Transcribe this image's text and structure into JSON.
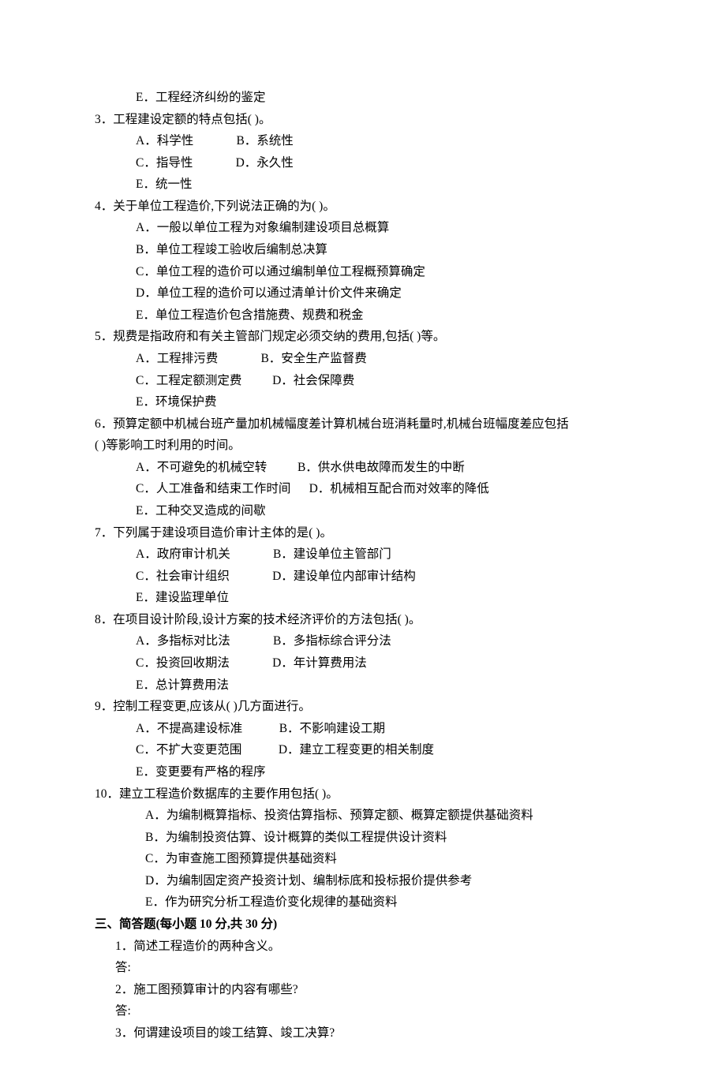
{
  "q2": {
    "optE": "E．工程经济纠纷的鉴定"
  },
  "q3": {
    "stem": "3．工程建设定额的特点包括(    )。",
    "row1": "A．科学性              B．系统性",
    "row2": "C．指导性              D．永久性",
    "row3": "E．统一性"
  },
  "q4": {
    "stem": "4．关于单位工程造价,下列说法正确的为(    )。",
    "a": "A．一般以单位工程为对象编制建设项目总概算",
    "b": "B．单位工程竣工验收后编制总决算",
    "c": "C．单位工程的造价可以通过编制单位工程概预算确定",
    "d": "D．单位工程的造价可以通过清单计价文件来确定",
    "e": "E．单位工程造价包含措施费、规费和税金"
  },
  "q5": {
    "stem": "5．规费是指政府和有关主管部门规定必须交纳的费用,包括(    )等。",
    "row1": "A．工程排污费              B．安全生产监督费",
    "row2": "C．工程定额测定费          D．社会保障费",
    "row3": "E．环境保护费"
  },
  "q6": {
    "stem1": "6．预算定额中机械台班产量加机械幅度差计算机械台班消耗量时,机械台班幅度差应包括",
    "stem2": "(    )等影响工时利用的时间。",
    "row1": "A．不可避免的机械空转          B．供水供电故障而发生的中断",
    "row2": "C．人工准备和结束工作时间      D．机械相互配合而对效率的降低",
    "row3": "E．工种交叉造成的间歇"
  },
  "q7": {
    "stem": "7．下列属于建设项目造价审计主体的是(    )。",
    "row1": "A．政府审计机关              B．建设单位主管部门",
    "row2": "C．社会审计组织              D．建设单位内部审计结构",
    "row3": "E．建设监理单位"
  },
  "q8": {
    "stem": "8．在项目设计阶段,设计方案的技术经济评价的方法包括(    )。",
    "row1": "A．多指标对比法              B．多指标综合评分法",
    "row2": "C．投资回收期法              D．年计算费用法",
    "row3": "E．总计算费用法"
  },
  "q9": {
    "stem": "9．控制工程变更,应该从(    )几方面进行。",
    "row1": "A．不提高建设标准            B．不影响建设工期",
    "row2": "C．不扩大变更范围            D．建立工程变更的相关制度",
    "row3": "E．变更要有严格的程序"
  },
  "q10": {
    "stem": "10．建立工程造价数据库的主要作用包括(    )。",
    "a": "A．为编制概算指标、投资估算指标、预算定额、概算定额提供基础资料",
    "b": "B．为编制投资估算、设计概算的类似工程提供设计资料",
    "c": "C．为审查施工图预算提供基础资料",
    "d": "D．为编制固定资产投资计划、编制标底和投标报价提供参考",
    "e": "E．作为研究分析工程造价变化规律的基础资料"
  },
  "section3": {
    "title": "三、简答题(每小题 10 分,共 30 分)",
    "q1": "1．简述工程造价的两种含义。",
    "ans": "答:",
    "q2": "2．施工图预算审计的内容有哪些?",
    "q3": "3．何谓建设项目的竣工结算、竣工决算?"
  }
}
